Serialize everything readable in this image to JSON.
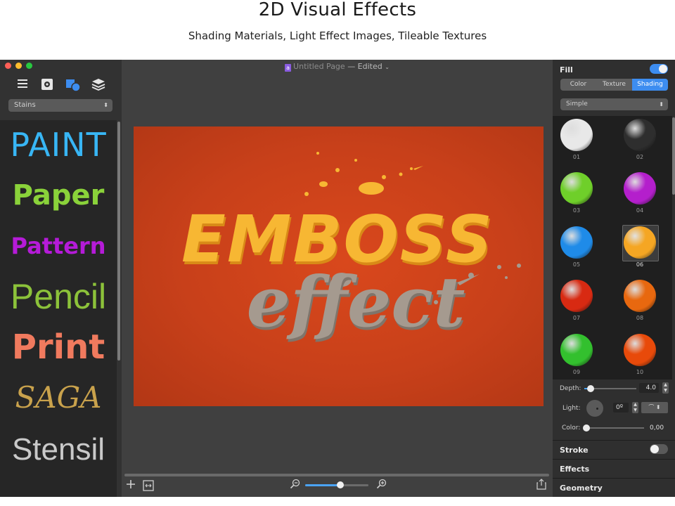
{
  "header": {
    "title": "2D Visual Effects",
    "subtitle": "Shading Materials, Light Effect Images, Tileable Textures"
  },
  "window": {
    "document_name": "Untitled Page",
    "document_status": "— Edited"
  },
  "left_panel": {
    "category_select": "Stains",
    "presets": [
      {
        "label": "PAINT",
        "color": "#38b6f5"
      },
      {
        "label": "Paper",
        "color": "#8ad23a"
      },
      {
        "label": "Pattern",
        "color": "#b51bd8"
      },
      {
        "label": "Pencil",
        "color": "#8cc23a"
      },
      {
        "label": "Print",
        "color": "#f07a5e"
      },
      {
        "label": "SAGA",
        "color": "#c9a24c"
      },
      {
        "label": "Stensil",
        "color": "#c9c9c9"
      }
    ]
  },
  "canvas": {
    "line1": "EMBOSS",
    "line2": "effect",
    "background_color": "#d2431b",
    "line1_color": "#f7b733",
    "line2_color": "#a59a8f",
    "zoom_level": 0.55
  },
  "inspector": {
    "fill_label": "Fill",
    "fill_enabled": true,
    "tabs": [
      "Color",
      "Texture",
      "Shading"
    ],
    "active_tab": "Shading",
    "shading_select": "Simple",
    "swatches": [
      {
        "label": "01",
        "color": "#e8e8e8"
      },
      {
        "label": "02",
        "color": "#2e2e2e"
      },
      {
        "label": "03",
        "color": "#6fcf2a"
      },
      {
        "label": "04",
        "color": "#b41fcc"
      },
      {
        "label": "05",
        "color": "#1f8be8"
      },
      {
        "label": "06",
        "color": "#f5a623"
      },
      {
        "label": "07",
        "color": "#d82a12"
      },
      {
        "label": "08",
        "color": "#e8680f"
      },
      {
        "label": "09",
        "color": "#33c02e"
      },
      {
        "label": "10",
        "color": "#e84a0a"
      }
    ],
    "selected_swatch": "06",
    "depth_label": "Depth:",
    "depth_value": "4.0",
    "depth_fraction": 0.12,
    "light_label": "Light:",
    "light_value": "0º",
    "color_label": "Color:",
    "color_value": "0,00",
    "color_fraction": 0.0,
    "stroke_label": "Stroke",
    "stroke_enabled": false,
    "effects_label": "Effects",
    "geometry_label": "Geometry"
  }
}
